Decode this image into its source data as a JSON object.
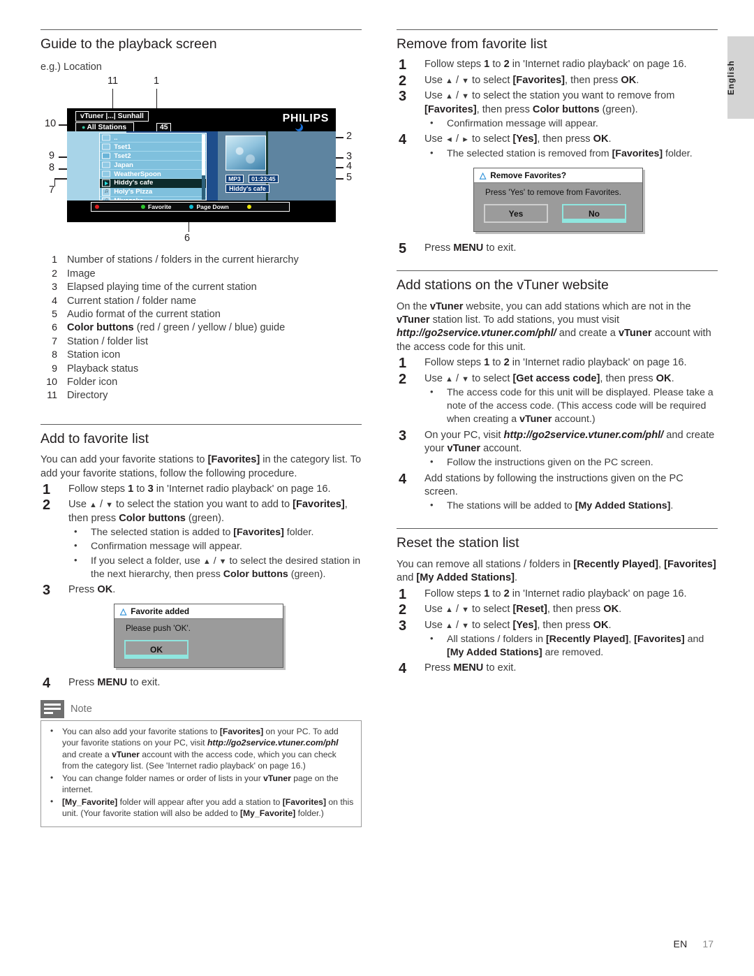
{
  "page": {
    "language_tab": "English",
    "footer_locale": "EN",
    "footer_page": "17"
  },
  "left_column": {
    "guide_section": {
      "heading": "Guide to the playback screen",
      "example_label": "e.g.) Location",
      "screen": {
        "brand": "PHILIPS",
        "breadcrumb": "vTuner |...| Sunhall",
        "category": "All Stations",
        "count": "45",
        "list_items": [
          {
            "label": "..",
            "icon": "folder-icon",
            "selected": false
          },
          {
            "label": "Tset1",
            "icon": "folder-icon",
            "selected": false
          },
          {
            "label": "Tset2",
            "icon": "folder-icon",
            "selected": false
          },
          {
            "label": "Japan",
            "icon": "folder-icon",
            "selected": false
          },
          {
            "label": "WeatherSpoon",
            "icon": "folder-icon",
            "selected": false
          },
          {
            "label": "Hiddy's cafe",
            "icon": "play-icon",
            "selected": true
          },
          {
            "label": "Holy's Pizza",
            "icon": "station-icon",
            "selected": false
          },
          {
            "label": "Miyazake",
            "icon": "station-icon",
            "selected": false
          }
        ],
        "audio_format": "MP3",
        "elapsed_time": "01:23:45",
        "now_playing": "Hiddy's cafe",
        "color_guide": [
          {
            "color": "red",
            "label": ""
          },
          {
            "color": "green",
            "label": "Favorite"
          },
          {
            "color": "blue",
            "label": "Page Down"
          },
          {
            "color": "yellow",
            "label": ""
          }
        ]
      },
      "callouts": [
        "1",
        "2",
        "3",
        "4",
        "5",
        "6",
        "7",
        "8",
        "9",
        "10",
        "11"
      ],
      "legend": [
        {
          "n": "1",
          "text": "Number of stations / folders in the current hierarchy"
        },
        {
          "n": "2",
          "text": "Image"
        },
        {
          "n": "3",
          "text": "Elapsed playing time of the current station"
        },
        {
          "n": "4",
          "text": "Current station / folder name"
        },
        {
          "n": "5",
          "text": "Audio format of the current station"
        },
        {
          "n": "6",
          "text": "Color buttons (red / green / yellow / blue) guide"
        },
        {
          "n": "7",
          "text": "Station / folder list"
        },
        {
          "n": "8",
          "text": "Station icon"
        },
        {
          "n": "9",
          "text": "Playback status"
        },
        {
          "n": "10",
          "text": "Folder icon"
        },
        {
          "n": "11",
          "text": "Directory"
        }
      ]
    },
    "add_favorite": {
      "heading": "Add to favorite list",
      "intro": "You can add your favorite stations to [Favorites] in the category list. To add your favorite stations, follow the following procedure.",
      "step1": "Follow steps 1 to 3 in 'Internet radio playback' on page 16.",
      "step2": "Use ▲ / ▼ to select the station you want to add to [Favorites], then press Color buttons (green).",
      "step2_bullets": [
        "The selected station is added to [Favorites] folder.",
        "Confirmation message will appear.",
        "If you select a folder, use ▲ / ▼ to select the desired station in the next hierarchy, then press Color buttons (green)."
      ],
      "step3": "Press OK.",
      "step4": "Press MENU to exit.",
      "dialog": {
        "title": "Favorite added",
        "message": "Please push 'OK'.",
        "ok_button": "OK"
      },
      "note": {
        "label": "Note",
        "items": [
          "You can also add your favorite stations to [Favorites] on your PC. To add your favorite stations on your PC, visit http://go2service.vtuner.com/phl and create a vTuner account with the access code, which you can check from the category list. (See 'Internet radio playback' on page 16.)",
          "You can change folder names or order of lists in your vTuner page on the internet.",
          "[My_Favorite] folder will appear after you add a station to [Favorites] on this unit. (Your favorite station will also be added to [My_Favorite] folder.)"
        ]
      }
    }
  },
  "right_column": {
    "remove_favorite": {
      "heading": "Remove from favorite list",
      "step1": "Follow steps 1 to 2 in 'Internet radio playback' on page 16.",
      "step2": "Use ▲ / ▼ to select [Favorites], then press OK.",
      "step3": "Use ▲ / ▼ to select the station you want to remove from [Favorites], then press Color buttons (green).",
      "step3_bullets": [
        "Confirmation message will appear."
      ],
      "step4": "Use ◄ / ► to select [Yes], then press OK.",
      "step4_bullets": [
        "The selected station is removed from [Favorites] folder."
      ],
      "step5": "Press MENU to exit.",
      "dialog": {
        "title": "Remove Favorites?",
        "message": "Press 'Yes' to  remove from Favorites.",
        "yes_button": "Yes",
        "no_button": "No"
      }
    },
    "add_stations": {
      "heading": "Add stations on the vTuner website",
      "intro": "On the vTuner website, you can add stations which are not in the vTuner station list. To add stations, you must visit http://go2service.vtuner.com/phl/ and create a vTuner account with the access code for this unit.",
      "step1": "Follow steps 1 to 2 in 'Internet radio playback' on page 16.",
      "step2": "Use ▲ / ▼ to select [Get access code], then press OK.",
      "step2_bullets": [
        "The access code for this unit will be displayed. Please take a note of the access code. (This access code will be required when creating a vTuner account.)"
      ],
      "step3": "On your PC, visit http://go2service.vtuner.com/phl/ and create your vTuner account.",
      "step3_bullets": [
        "Follow the instructions given on the PC screen."
      ],
      "step4": "Add stations by following the instructions given on the PC screen.",
      "step4_bullets": [
        "The stations will be added to [My Added Stations]."
      ]
    },
    "reset_list": {
      "heading": "Reset the station list",
      "intro": "You can remove all stations / folders in [Recently Played], [Favorites] and [My Added Stations].",
      "step1": "Follow steps 1 to 2 in 'Internet radio playback' on page 16.",
      "step2": "Use ▲ / ▼ to select [Reset], then press OK.",
      "step3": "Use ▲ / ▼ to select [Yes], then press OK.",
      "step3_bullets": [
        "All stations / folders in [Recently Played], [Favorites]  and [My Added Stations] are removed."
      ],
      "step4": "Press MENU to exit."
    }
  }
}
